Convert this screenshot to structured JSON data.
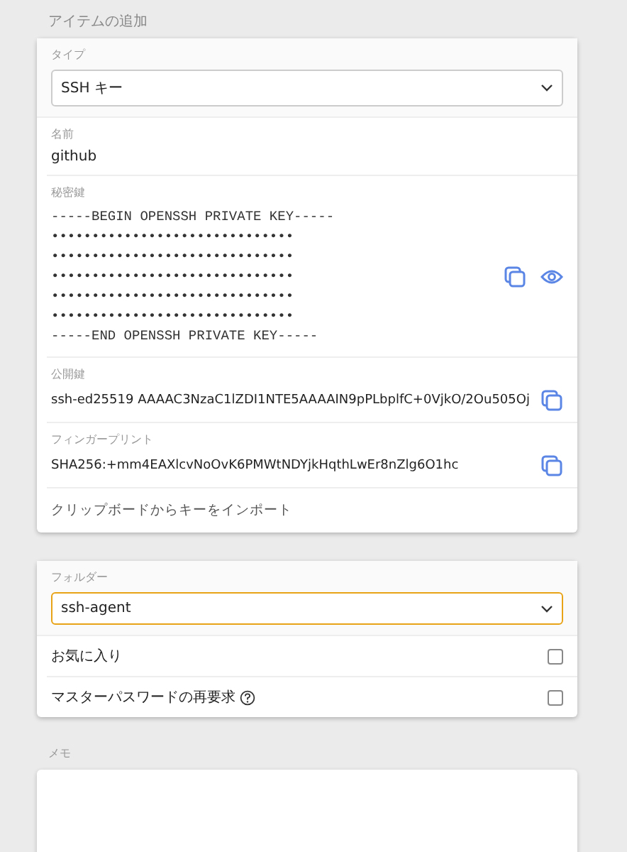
{
  "heading": "アイテムの追加",
  "details": {
    "type": {
      "label": "タイプ",
      "value": "SSH キー"
    },
    "name": {
      "label": "名前",
      "value": "github"
    },
    "private_key": {
      "label": "秘密鍵",
      "lines": [
        "-----BEGIN OPENSSH PRIVATE KEY-----",
        "••••••••••••••••••••••••••••••",
        "••••••••••••••••••••••••••••••",
        "••••••••••••••••••••••••••••••",
        "••••••••••••••••••••••••••••••",
        "••••••••••••••••••••••••••••••",
        "-----END OPENSSH PRIVATE KEY-----"
      ]
    },
    "public_key": {
      "label": "公開鍵",
      "value": "ssh-ed25519 AAAAC3NzaC1lZDI1NTE5AAAAIN9pPLbplfC+0VjkO/2Ou505Oj"
    },
    "fingerprint": {
      "label": "フィンガープリント",
      "value": "SHA256:+mm4EAXlcvNoOvK6PMWtNDYjkHqthLwEr8nZlg6O1hc"
    },
    "import_link": "クリップボードからキーをインポート"
  },
  "options": {
    "folder": {
      "label": "フォルダー",
      "value": "ssh-agent",
      "focused": true
    },
    "toggles": [
      {
        "label": "お気に入り",
        "checked": false,
        "help": false
      },
      {
        "label": "マスターパスワードの再要求",
        "checked": false,
        "help": true
      }
    ]
  },
  "notes": {
    "label": "メモ"
  }
}
